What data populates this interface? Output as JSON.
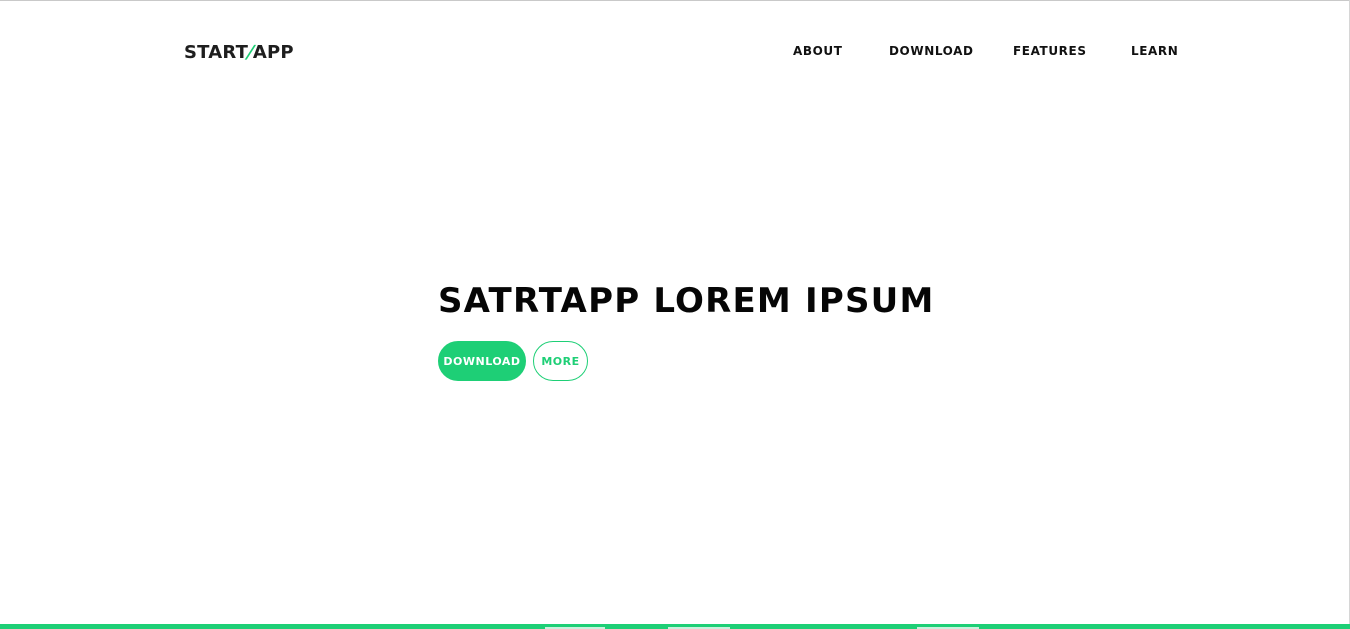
{
  "header": {
    "logo_left": "START",
    "logo_slash": "/",
    "logo_right": "APP",
    "nav": {
      "about": "ABOUT",
      "download": "DOWNLOAD",
      "features": "FEATURES",
      "learn": "LEARN"
    }
  },
  "hero": {
    "title": "SATRTAPP LOREM IPSUM",
    "primary_button": "DOWNLOAD",
    "secondary_button": "MORE"
  },
  "colors": {
    "accent": "#1ecf76",
    "text": "#060606",
    "background": "#ffffff"
  }
}
